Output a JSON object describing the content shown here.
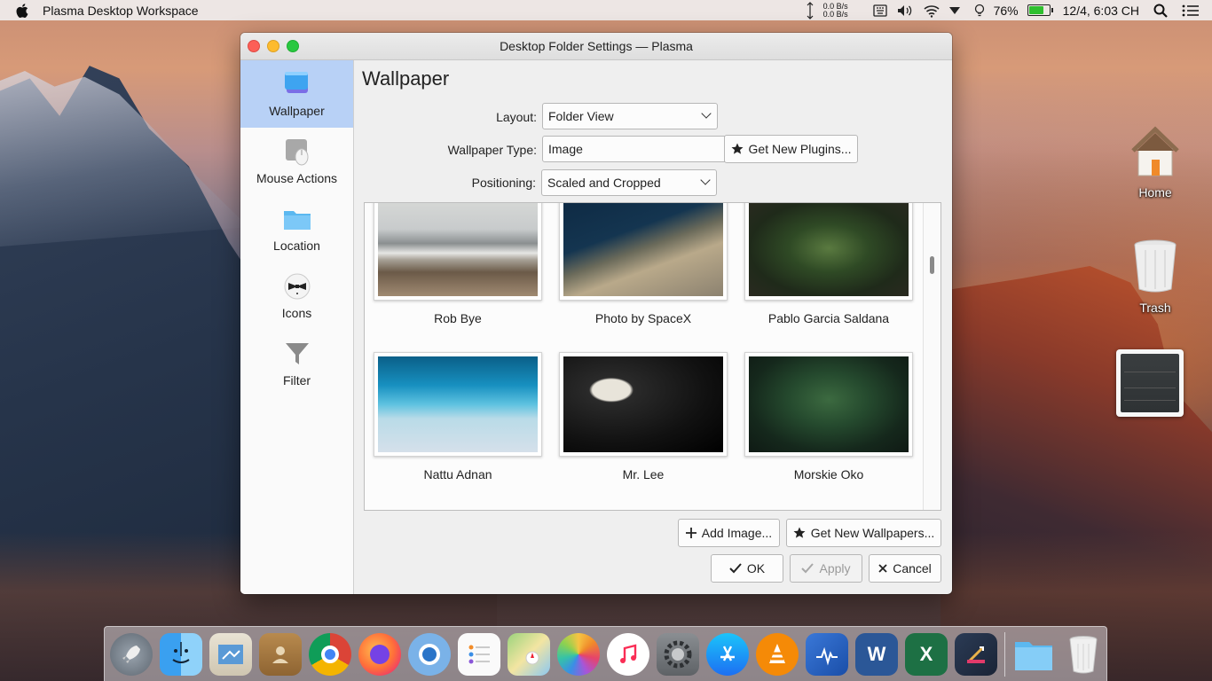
{
  "menubar": {
    "app_title": "Plasma Desktop Workspace",
    "net_up": "0.0 B/s",
    "net_down": "0.0 B/s",
    "battery_percent": "76%",
    "battery_level": 0.76,
    "datetime": "12/4, 6:03 CH"
  },
  "desktop": {
    "home_label": "Home",
    "trash_label": "Trash"
  },
  "window": {
    "title": "Desktop Folder Settings — Plasma",
    "sidebar": [
      {
        "label": "Wallpaper"
      },
      {
        "label": "Mouse Actions"
      },
      {
        "label": "Location"
      },
      {
        "label": "Icons"
      },
      {
        "label": "Filter"
      }
    ],
    "page_title": "Wallpaper",
    "form": {
      "layout_label": "Layout:",
      "layout_value": "Folder View",
      "type_label": "Wallpaper Type:",
      "type_value": "Image",
      "get_plugins": "Get New Plugins...",
      "positioning_label": "Positioning:",
      "positioning_value": "Scaled and Cropped"
    },
    "wallpapers": [
      {
        "name": "Rob Bye"
      },
      {
        "name": "Photo by SpaceX"
      },
      {
        "name": "Pablo Garcia Saldana"
      },
      {
        "name": "Nattu Adnan"
      },
      {
        "name": "Mr. Lee"
      },
      {
        "name": "Morskie Oko"
      }
    ],
    "buttons": {
      "add_image": "Add Image...",
      "get_wallpapers": "Get New Wallpapers...",
      "ok": "OK",
      "apply": "Apply",
      "cancel": "Cancel"
    }
  },
  "dock": {
    "items": [
      "launchpad-icon",
      "finder-icon",
      "mail-icon",
      "contacts-icon",
      "chrome-icon",
      "firefox-icon",
      "chromium-icon",
      "reminders-icon",
      "maps-icon",
      "photos-icon",
      "music-icon",
      "system-preferences-icon",
      "app-store-icon",
      "vlc-icon",
      "activity-monitor-icon",
      "word-icon",
      "excel-icon",
      "dev-tool-icon",
      "downloads-folder-icon",
      "trash-icon"
    ]
  },
  "colors": {
    "selection": "#b8d1f6",
    "close": "#fc5f57",
    "minimize": "#fdbb2e",
    "maximize": "#29c840"
  }
}
